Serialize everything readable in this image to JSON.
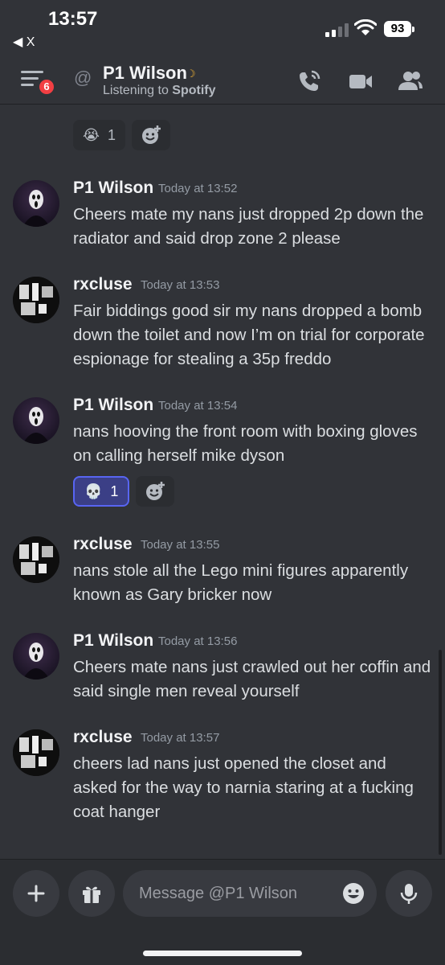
{
  "status_bar": {
    "time": "13:57",
    "back_label": "X",
    "battery": "93"
  },
  "header": {
    "unread_count": "6",
    "at_symbol": "@",
    "name": "P1 Wilson",
    "status_prefix": "Listening to ",
    "status_app": "Spotify"
  },
  "top_reactions": [
    {
      "emoji": "😭",
      "count": "1"
    }
  ],
  "messages": [
    {
      "author": "P1 Wilson",
      "timestamp": "Today at 13:52",
      "text": "Cheers mate my nans just dropped 2p down the radiator and said drop zone 2 please"
    },
    {
      "author": "rxcluse",
      "timestamp": "Today at 13:53",
      "text": "Fair biddings good sir my nans dropped a bomb down the toilet and now I’m on trial for corporate espionage for stealing a 35p freddo"
    },
    {
      "author": "P1 Wilson",
      "timestamp": "Today at 13:54",
      "text": "nans hooving the front room with boxing gloves on calling herself mike dyson",
      "reaction": {
        "emoji": "💀",
        "count": "1"
      }
    },
    {
      "author": "rxcluse",
      "timestamp": "Today at 13:55",
      "text": "nans stole all the Lego mini figures apparently known as Gary bricker now"
    },
    {
      "author": "P1 Wilson",
      "timestamp": "Today at 13:56",
      "text": "Cheers mate nans just crawled out her coffin and said single men reveal yourself"
    },
    {
      "author": "rxcluse",
      "timestamp": "Today at 13:57",
      "text": "cheers lad nans just opened the closet and asked for the way to narnia staring at a fucking coat hanger"
    }
  ],
  "composer": {
    "placeholder": "Message @P1 Wilson"
  },
  "colors": {
    "background": "#313338",
    "accent": "#5865f2",
    "badge": "#f23f43"
  }
}
